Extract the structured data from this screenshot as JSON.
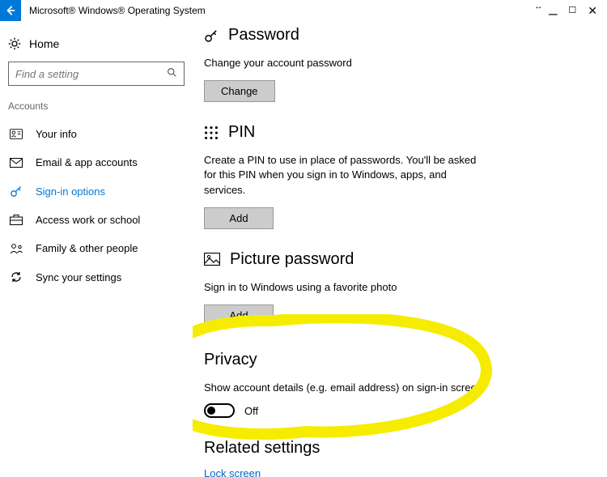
{
  "titlebar": {
    "app_title": "Microsoft® Windows® Operating System"
  },
  "sidebar": {
    "home_label": "Home",
    "search_placeholder": "Find a setting",
    "category": "Accounts",
    "items": [
      {
        "label": "Your info"
      },
      {
        "label": "Email & app accounts"
      },
      {
        "label": "Sign-in options"
      },
      {
        "label": "Access work or school"
      },
      {
        "label": "Family & other people"
      },
      {
        "label": "Sync your settings"
      }
    ]
  },
  "content": {
    "password": {
      "heading": "Password",
      "desc": "Change your account password",
      "button": "Change"
    },
    "pin": {
      "heading": "PIN",
      "desc": "Create a PIN to use in place of passwords. You'll be asked for this PIN when you sign in to Windows, apps, and services.",
      "button": "Add"
    },
    "picture": {
      "heading": "Picture password",
      "desc": "Sign in to Windows using a favorite photo",
      "button": "Add"
    },
    "privacy": {
      "heading": "Privacy",
      "desc": "Show account details (e.g. email address) on sign-in screen",
      "toggle_state": "Off"
    },
    "related": {
      "heading": "Related settings",
      "link": "Lock screen"
    }
  }
}
